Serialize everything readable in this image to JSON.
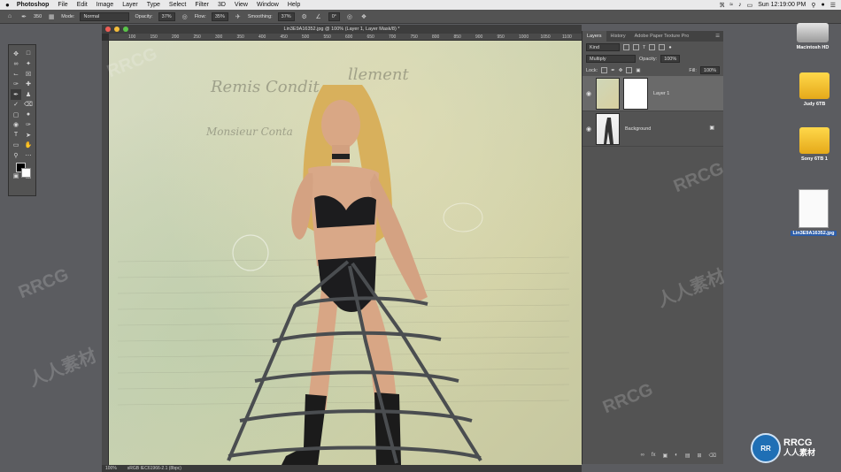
{
  "menubar": {
    "app": "Photoshop",
    "items": [
      "File",
      "Edit",
      "Image",
      "Layer",
      "Type",
      "Select",
      "Filter",
      "3D",
      "View",
      "Window",
      "Help"
    ],
    "clock": "Sun 12:19:00 PM"
  },
  "options_bar": {
    "brush_size": "350",
    "mode_label": "Mode:",
    "mode_value": "Normal",
    "opacity_label": "Opacity:",
    "opacity_value": "37%",
    "flow_label": "Flow:",
    "flow_value": "35%",
    "smoothing_label": "Smoothing:",
    "smoothing_value": "37%",
    "angle_value": "0°"
  },
  "document": {
    "title": "Lin3E9A16352.jpg @ 100% (Layer 1, Layer Mask/8) *",
    "ruler_ticks": [
      "100",
      "150",
      "200",
      "250",
      "300",
      "350",
      "400",
      "450",
      "500",
      "550",
      "600",
      "650",
      "700",
      "750",
      "800",
      "850",
      "900",
      "950",
      "1000",
      "1050",
      "1100"
    ],
    "status_zoom": "100%",
    "status_profile": "sRGB IEC61966-2.1 (8bpc)",
    "canvas_text": {
      "line1": "Remis Condit",
      "line2": "llement",
      "line3": "Monsieur Conta"
    }
  },
  "layers_panel": {
    "tabs": [
      "Layers",
      "History",
      "Adobe Paper Texture Pro"
    ],
    "kind_label": "Kind",
    "blend_mode": "Multiply",
    "opacity_label": "Opacity:",
    "opacity_value": "100%",
    "lock_label": "Lock:",
    "fill_label": "Fill:",
    "fill_value": "100%",
    "layers": [
      {
        "name": "Layer 1"
      },
      {
        "name": "Background"
      }
    ]
  },
  "desktop": {
    "icons": [
      {
        "name": "Macintosh HD"
      },
      {
        "name": "Judy 6TB"
      },
      {
        "name": "Sony 6TB 1"
      },
      {
        "name": "Lin3E9A16352.jpg"
      }
    ]
  },
  "watermarks": {
    "rrcg": "RRCG",
    "cn": "人人素材"
  },
  "colors": {
    "accent_blue": "#2b5ca8",
    "drive_yellow": "#f6c22b"
  }
}
